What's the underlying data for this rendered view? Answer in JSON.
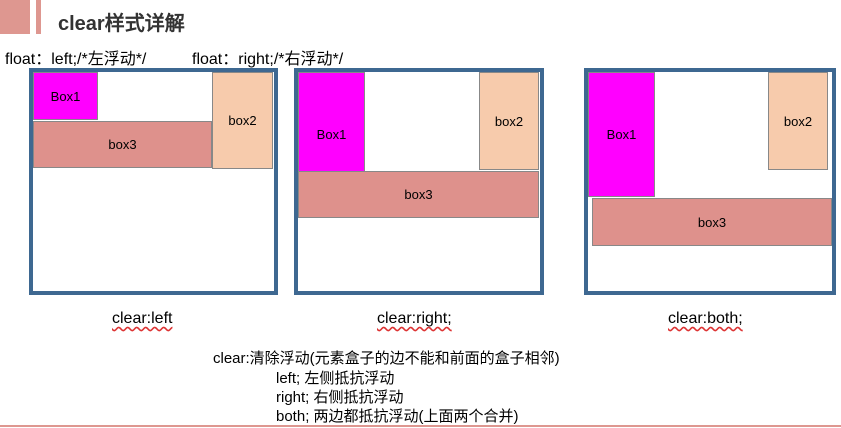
{
  "header": {
    "title": "clear样式详解"
  },
  "float_labels": {
    "left": "float：left;/*左浮动*/",
    "right": "float：right;/*右浮动*/"
  },
  "diagrams": [
    {
      "box1": "Box1",
      "box2": "box2",
      "box3": "box3",
      "caption": "clear:left"
    },
    {
      "box1": "Box1",
      "box2": "box2",
      "box3": "box3",
      "caption": "clear:right;"
    },
    {
      "box1": "Box1",
      "box2": "box2",
      "box3": "box3",
      "caption": "clear:both;"
    }
  ],
  "description": {
    "line1": "clear:清除浮动(元素盒子的边不能和前面的盒子相邻)",
    "line2": "left; 左侧抵抗浮动",
    "line3": "right; 右侧抵抗浮动",
    "line4": "both; 两边都抵抗浮动(上面两个合并)"
  },
  "colors": {
    "accent": "#de9790",
    "border": "#3e6891",
    "box1": "#ff00ff",
    "box2": "#f7cbac",
    "box3": "#de918c"
  }
}
